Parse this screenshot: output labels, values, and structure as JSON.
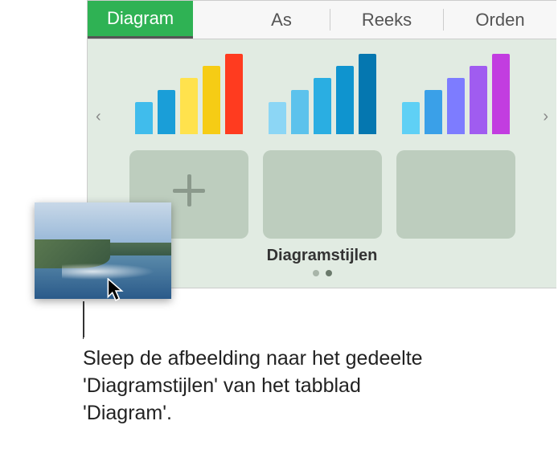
{
  "tabs": {
    "diagram": "Diagram",
    "as": "As",
    "reeks": "Reeks",
    "orden": "Orden"
  },
  "chart_styles": {
    "section_title": "Diagramstijlen",
    "palettes": [
      {
        "colors": [
          "#40bcec",
          "#1a9ed8",
          "#ffe24d",
          "#f6cc15",
          "#ff3b1f"
        ],
        "heights": [
          40,
          55,
          70,
          85,
          100
        ]
      },
      {
        "colors": [
          "#8cd6f5",
          "#5cc2ec",
          "#2aaee2",
          "#0f94cf",
          "#0577b0"
        ],
        "heights": [
          40,
          55,
          70,
          85,
          100
        ]
      },
      {
        "colors": [
          "#5fd0f5",
          "#3aa0e8",
          "#7d7cff",
          "#a05cf0",
          "#c23de0"
        ],
        "heights": [
          40,
          55,
          70,
          85,
          100
        ]
      }
    ]
  },
  "pager": {
    "count": 2,
    "active": 1
  },
  "icons": {
    "nav_left": "‹",
    "nav_right": "›"
  },
  "drag_image": {
    "alt": "coastline-photo"
  },
  "caption": "Sleep de afbeelding naar het gedeelte 'Diagramstijlen' van het tabblad 'Diagram'."
}
